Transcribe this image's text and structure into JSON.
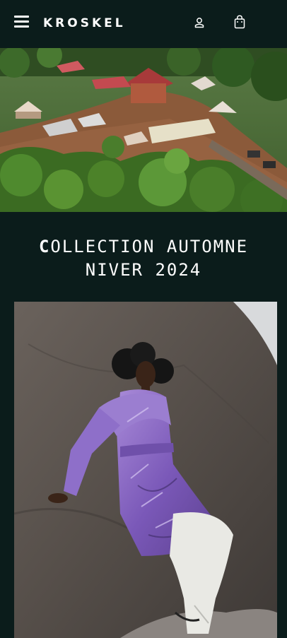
{
  "brand": {
    "name": "KROSKEL"
  },
  "header": {
    "menu_icon": "hamburger-menu-icon",
    "account_icon": "user-icon",
    "cart_icon": "shopping-bag-icon"
  },
  "hero": {
    "image_kind": "aerial village photo"
  },
  "collection": {
    "title_first_letter": "C",
    "title_line1_rest": "OLLECTION AUTOMNE",
    "title_line2": "NIVER 2024"
  },
  "colors": {
    "background": "#0b1c1b",
    "text": "#ffffff",
    "accent_coat": "#8a63c8"
  }
}
